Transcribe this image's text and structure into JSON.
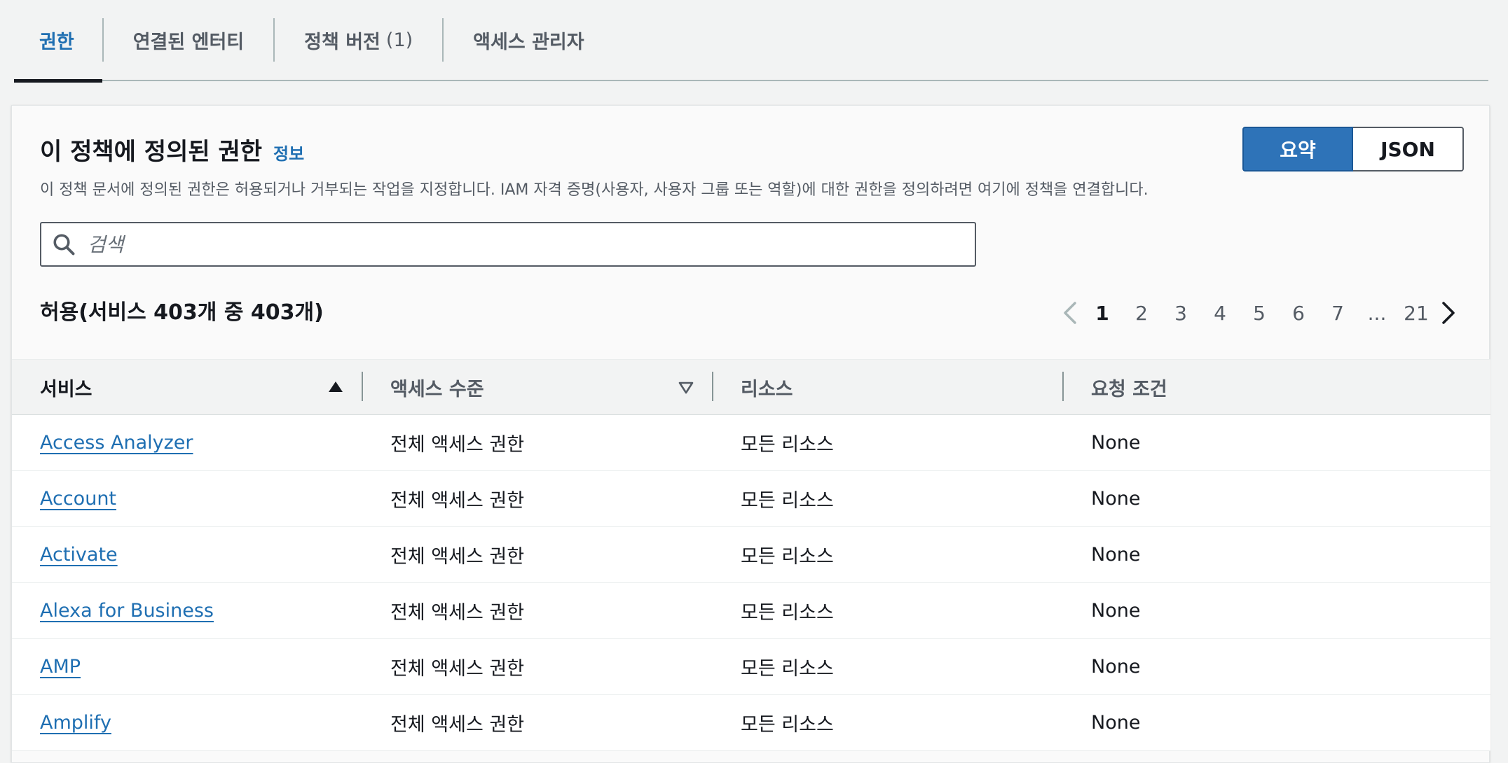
{
  "tabs": [
    {
      "label": "권한",
      "active": true
    },
    {
      "label": "연결된 엔터티"
    },
    {
      "label": "정책 버전",
      "count": "(1)"
    },
    {
      "label": "액세스 관리자"
    }
  ],
  "panel": {
    "title": "이 정책에 정의된 권한",
    "info_link": "정보",
    "description": "이 정책 문서에 정의된 권한은 허용되거나 거부되는 작업을 지정합니다. IAM 자격 증명(사용자, 사용자 그룹 또는 역할)에 대한 권한을 정의하려면 여기에 정책을 연결합니다.",
    "view_toggle": {
      "summary": "요약",
      "json": "JSON",
      "selected": "summary"
    },
    "search": {
      "placeholder": "검색",
      "value": ""
    },
    "allowed_title": "허용(서비스 403개 중 403개)"
  },
  "pagination": {
    "pages": [
      "1",
      "2",
      "3",
      "4",
      "5",
      "6",
      "7"
    ],
    "ellipsis": "...",
    "last": "21",
    "current": "1"
  },
  "table": {
    "headers": {
      "service": "서비스",
      "access_level": "액세스 수준",
      "resource": "리소스",
      "request_condition": "요청 조건"
    },
    "rows": [
      {
        "service": "Access Analyzer",
        "access_level": "전체 액세스 권한",
        "resource": "모든 리소스",
        "condition": "None"
      },
      {
        "service": "Account",
        "access_level": "전체 액세스 권한",
        "resource": "모든 리소스",
        "condition": "None"
      },
      {
        "service": "Activate",
        "access_level": "전체 액세스 권한",
        "resource": "모든 리소스",
        "condition": "None"
      },
      {
        "service": "Alexa for Business",
        "access_level": "전체 액세스 권한",
        "resource": "모든 리소스",
        "condition": "None"
      },
      {
        "service": "AMP",
        "access_level": "전체 액세스 권한",
        "resource": "모든 리소스",
        "condition": "None"
      },
      {
        "service": "Amplify",
        "access_level": "전체 액세스 권한",
        "resource": "모든 리소스",
        "condition": "None"
      }
    ]
  },
  "colors": {
    "link": "#1f6fb2",
    "toggle_selected": "#2e73b8",
    "text": "#16191f",
    "muted": "#545b64"
  }
}
